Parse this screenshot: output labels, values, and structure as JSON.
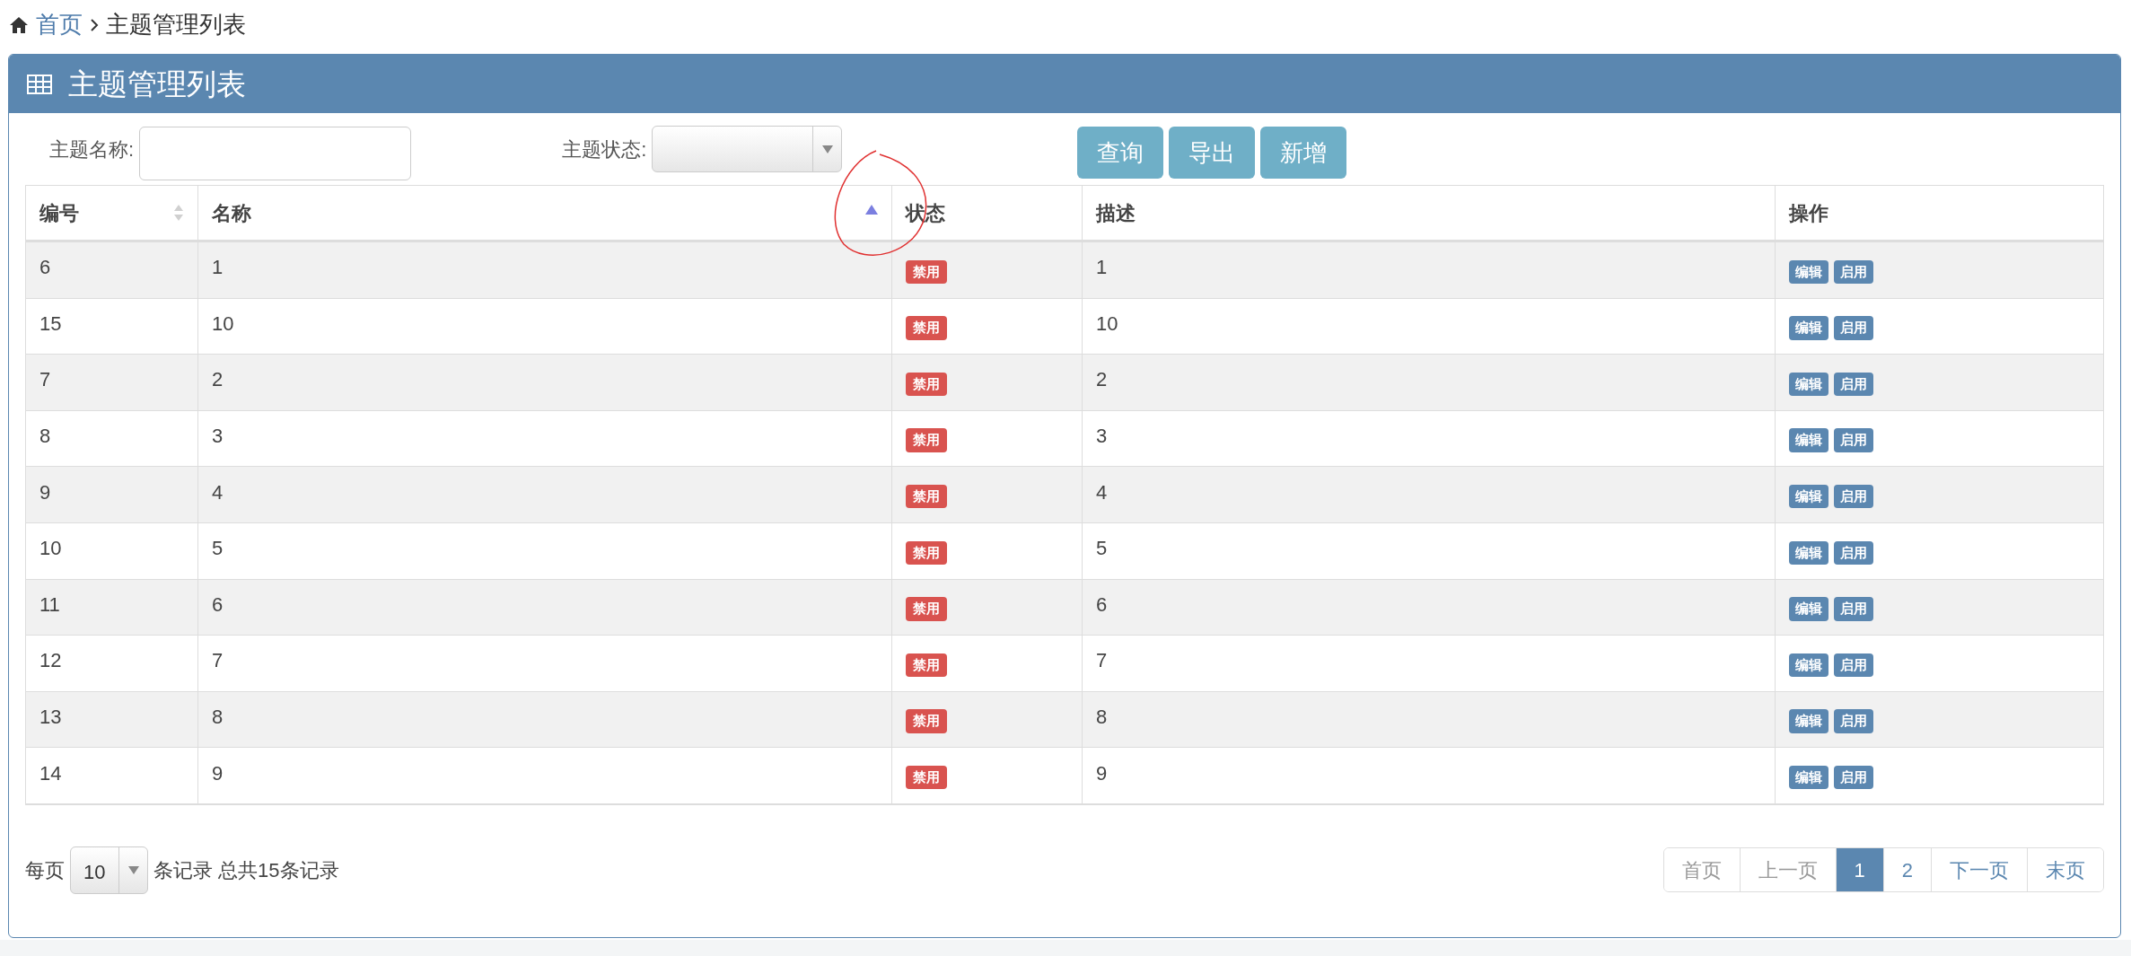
{
  "breadcrumb": [
    {
      "label": "首页",
      "link": true
    },
    {
      "label": "主题管理列表",
      "link": false
    }
  ],
  "panel": {
    "title": "主题管理列表"
  },
  "filters": {
    "name_label": "主题名称:",
    "status_label": "主题状态:",
    "buttons": [
      "查询",
      "导出",
      "新增"
    ]
  },
  "table": {
    "columns": [
      {
        "label": "编号",
        "sortable": true,
        "sorted": false
      },
      {
        "label": "名称",
        "sortable": true,
        "sorted": true
      },
      {
        "label": "状态",
        "sortable": false,
        "sorted": false
      },
      {
        "label": "描述",
        "sortable": false,
        "sorted": false
      },
      {
        "label": "操作",
        "sortable": false,
        "sorted": false
      }
    ],
    "rows": [
      {
        "id": "6",
        "name": "1",
        "status": "禁用",
        "desc": "1",
        "actions": [
          "编辑",
          "启用"
        ]
      },
      {
        "id": "15",
        "name": "10",
        "status": "禁用",
        "desc": "10",
        "actions": [
          "编辑",
          "启用"
        ]
      },
      {
        "id": "7",
        "name": "2",
        "status": "禁用",
        "desc": "2",
        "actions": [
          "编辑",
          "启用"
        ]
      },
      {
        "id": "8",
        "name": "3",
        "status": "禁用",
        "desc": "3",
        "actions": [
          "编辑",
          "启用"
        ]
      },
      {
        "id": "9",
        "name": "4",
        "status": "禁用",
        "desc": "4",
        "actions": [
          "编辑",
          "启用"
        ]
      },
      {
        "id": "10",
        "name": "5",
        "status": "禁用",
        "desc": "5",
        "actions": [
          "编辑",
          "启用"
        ]
      },
      {
        "id": "11",
        "name": "6",
        "status": "禁用",
        "desc": "6",
        "actions": [
          "编辑",
          "启用"
        ]
      },
      {
        "id": "12",
        "name": "7",
        "status": "禁用",
        "desc": "7",
        "actions": [
          "编辑",
          "启用"
        ]
      },
      {
        "id": "13",
        "name": "8",
        "status": "禁用",
        "desc": "8",
        "actions": [
          "编辑",
          "启用"
        ]
      },
      {
        "id": "14",
        "name": "9",
        "status": "禁用",
        "desc": "9",
        "actions": [
          "编辑",
          "启用"
        ]
      }
    ]
  },
  "footer": {
    "per_page_label": "每页",
    "per_page": "10",
    "summary": "条记录 总共15条记录"
  },
  "pagination": [
    {
      "label": "首页",
      "disabled": true,
      "selected": false
    },
    {
      "label": "上一页",
      "disabled": true,
      "selected": false
    },
    {
      "label": "1",
      "disabled": false,
      "selected": true
    },
    {
      "label": "2",
      "disabled": false,
      "selected": false
    },
    {
      "label": "下一页",
      "disabled": false,
      "selected": false
    },
    {
      "label": "末页",
      "disabled": false,
      "selected": false
    }
  ]
}
